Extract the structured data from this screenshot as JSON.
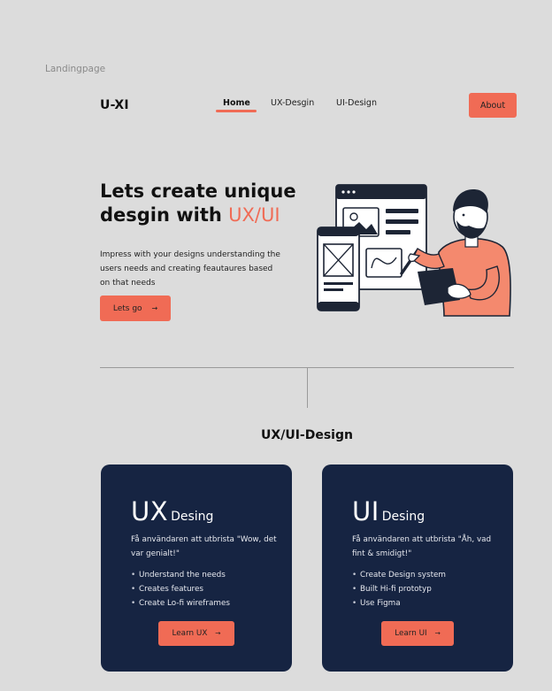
{
  "frame_label": "Landingpage",
  "header": {
    "logo": "U-XI",
    "nav": [
      {
        "label": "Home",
        "active": true
      },
      {
        "label": "UX-Desgin",
        "active": false
      },
      {
        "label": "UI-Design",
        "active": false
      }
    ],
    "about_label": "About"
  },
  "hero": {
    "title_line1": "Lets create unique",
    "title_line2_prefix": "desgin with ",
    "title_accent": "UX/UI",
    "description": "Impress with your designs understanding the users needs and creating feautaures based on that needs",
    "cta_label": "Lets go",
    "cta_arrow": "→"
  },
  "section": {
    "title": "UX/UI-Design"
  },
  "cards": [
    {
      "big": "UX",
      "small": "Desing",
      "description": "Få användaren att utbrista \"Wow, det var genialt!\"",
      "items": [
        "Understand the needs",
        "Creates features",
        "Create Lo-fi wireframes"
      ],
      "button_label": "Learn UX",
      "button_arrow": "→"
    },
    {
      "big": "UI",
      "small": "Desing",
      "description": "Få användaren att utbrista \"Åh, vad fint & smidigt!\"",
      "items": [
        "Create Design system",
        "Built Hi-fi prototyp",
        "Use Figma"
      ],
      "button_label": "Learn UI",
      "button_arrow": "→"
    }
  ],
  "colors": {
    "background": "#dcdcdc",
    "accent": "#f06b55",
    "card_bg": "#162442",
    "text": "#111111"
  },
  "icons": {
    "illustration": "designer-with-tablet-illustration",
    "arrow": "arrow-right-icon"
  }
}
